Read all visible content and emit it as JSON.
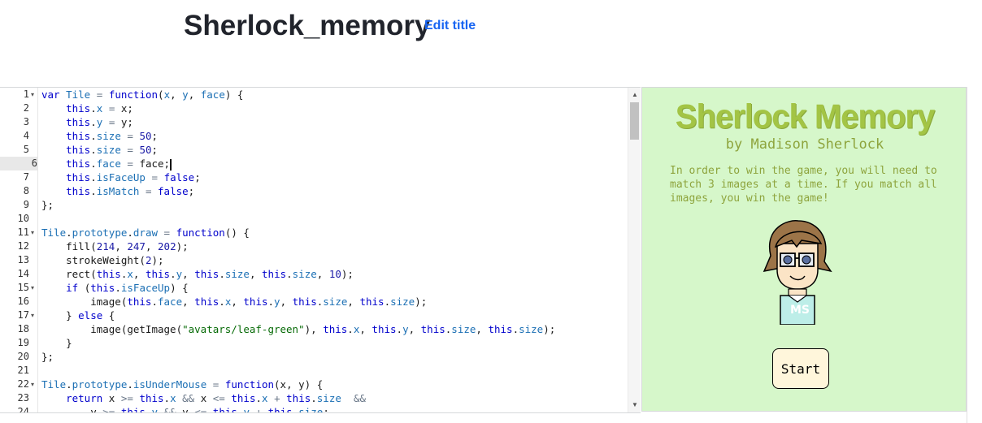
{
  "header": {
    "title": "Sherlock_memory",
    "edit_title_label": "Edit title"
  },
  "editor": {
    "active_line": 6,
    "lines": [
      {
        "n": "1",
        "fold": true,
        "html": "<span class='kw'>var</span> <span class='prop'>Tile</span> <span class='op'>=</span> <span class='kw'>function</span>(<span class='prop'>x</span>, <span class='prop'>y</span>, <span class='prop'>face</span>) {"
      },
      {
        "n": "2",
        "html": "    <span class='kw'>this</span>.<span class='prop'>x</span> <span class='op'>=</span> x;"
      },
      {
        "n": "3",
        "html": "    <span class='kw'>this</span>.<span class='prop'>y</span> <span class='op'>=</span> y;"
      },
      {
        "n": "4",
        "html": "    <span class='kw'>this</span>.<span class='prop'>size</span> <span class='op'>=</span> <span class='num'>50</span>;"
      },
      {
        "n": "5",
        "html": "    <span class='kw'>this</span>.<span class='prop'>size</span> <span class='op'>=</span> <span class='num'>50</span>;"
      },
      {
        "n": "6",
        "html": "    <span class='kw'>this</span>.<span class='prop'>face</span> <span class='op'>=</span> face;<span class='cursor'></span>"
      },
      {
        "n": "7",
        "html": "    <span class='kw'>this</span>.<span class='prop'>isFaceUp</span> <span class='op'>=</span> <span class='kw'>false</span>;"
      },
      {
        "n": "8",
        "html": "    <span class='kw'>this</span>.<span class='prop'>isMatch</span> <span class='op'>=</span> <span class='kw'>false</span>;"
      },
      {
        "n": "9",
        "html": "};"
      },
      {
        "n": "10",
        "html": ""
      },
      {
        "n": "11",
        "fold": true,
        "html": "<span class='prop'>Tile</span>.<span class='prop'>prototype</span>.<span class='prop'>draw</span> <span class='op'>=</span> <span class='kw'>function</span>() {"
      },
      {
        "n": "12",
        "html": "    fill(<span class='num'>214</span>, <span class='num'>247</span>, <span class='num'>202</span>);"
      },
      {
        "n": "13",
        "html": "    strokeWeight(<span class='num'>2</span>);"
      },
      {
        "n": "14",
        "html": "    rect(<span class='kw'>this</span>.<span class='prop'>x</span>, <span class='kw'>this</span>.<span class='prop'>y</span>, <span class='kw'>this</span>.<span class='prop'>size</span>, <span class='kw'>this</span>.<span class='prop'>size</span>, <span class='num'>10</span>);"
      },
      {
        "n": "15",
        "fold": true,
        "html": "    <span class='kw'>if</span> (<span class='kw'>this</span>.<span class='prop'>isFaceUp</span>) {"
      },
      {
        "n": "16",
        "html": "        image(<span class='kw'>this</span>.<span class='prop'>face</span>, <span class='kw'>this</span>.<span class='prop'>x</span>, <span class='kw'>this</span>.<span class='prop'>y</span>, <span class='kw'>this</span>.<span class='prop'>size</span>, <span class='kw'>this</span>.<span class='prop'>size</span>);"
      },
      {
        "n": "17",
        "fold": true,
        "html": "    } <span class='kw'>else</span> {"
      },
      {
        "n": "18",
        "html": "        image(getImage(<span class='str'>\"avatars/leaf-green\"</span>), <span class='kw'>this</span>.<span class='prop'>x</span>, <span class='kw'>this</span>.<span class='prop'>y</span>, <span class='kw'>this</span>.<span class='prop'>size</span>, <span class='kw'>this</span>.<span class='prop'>size</span>);"
      },
      {
        "n": "19",
        "html": "    }"
      },
      {
        "n": "20",
        "html": "};"
      },
      {
        "n": "21",
        "html": ""
      },
      {
        "n": "22",
        "fold": true,
        "html": "<span class='prop'>Tile</span>.<span class='prop'>prototype</span>.<span class='prop'>isUnderMouse</span> <span class='op'>=</span> <span class='kw'>function</span>(x, y) {"
      },
      {
        "n": "23",
        "html": "    <span class='kw'>return</span> x <span class='op'>&gt;=</span> <span class='kw'>this</span>.<span class='prop'>x</span> <span class='op'>&amp;&amp;</span> x <span class='op'>&lt;=</span> <span class='kw'>this</span>.<span class='prop'>x</span> <span class='op'>+</span> <span class='kw'>this</span>.<span class='prop'>size</span>  <span class='op'>&amp;&amp;</span>"
      },
      {
        "n": "24",
        "html": "        y <span class='op'>&gt;=</span> <span class='kw'>this</span>.<span class='prop'>y</span> <span class='op'>&amp;&amp;</span> y <span class='op'>&lt;=</span> <span class='kw'>this</span>.<span class='prop'>y</span> <span class='op'>+</span> <span class='kw'>this</span>.<span class='prop'>size</span>;"
      }
    ]
  },
  "game": {
    "title": "Sherlock Memory",
    "subtitle": "by Madison Sherlock",
    "description": "In order to win the game, you will need to match 3 images at a time. If you match all images, you win the game!",
    "avatar_initials": "MS",
    "start_label": "Start"
  },
  "colors": {
    "canvas_bg": "#d6f7ca",
    "title_green": "#a3c445",
    "text_green": "#8ea43d",
    "link_blue": "#1865f2"
  }
}
